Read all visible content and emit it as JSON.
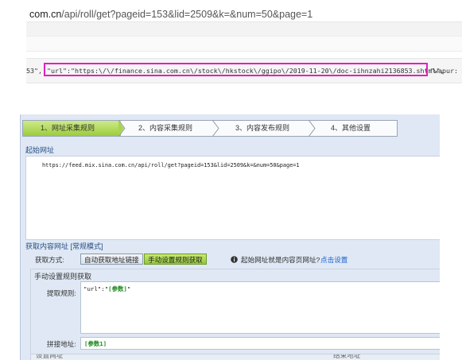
{
  "browser": {
    "url_prefix": "com.cn",
    "url_rest": "/api/roll/get?pageid=153&lid=2509&k=&num=50&page=1"
  },
  "json_view": {
    "before": "53\",",
    "highlight": "\"url\":\"https:\\/\\/finance.sina.com.cn\\/stock\\/hkstock\\/ggipo\\/2019-11-20\\/doc-iihnzahi2136853.shtml\",",
    "after": "\"wapur:"
  },
  "wizard": {
    "steps": [
      "1、网址采集规则",
      "2、内容采集规则",
      "3、内容发布规则",
      "4、其他设置"
    ],
    "active_color": "#a8d44e"
  },
  "start_url_section": {
    "title": "起始网址",
    "url": "https://feed.mix.sina.com.cn/api/roll/get?pageid=153&lid=2509&k=&num=50&page=1"
  },
  "content_url_section": {
    "title": "获取内容网址 [常规模式]",
    "method_label": "获取方式:",
    "auto_btn": "自动获取地址链接",
    "manual_btn": "手动设置规则获取",
    "hint": "起始网址就是内容页网址?",
    "hint_link": "点击设置"
  },
  "manual_section": {
    "title": "手动设置规则获取",
    "rule_label": "提取规则:",
    "rule_value_prefix": "\"url\":\"",
    "rule_value_param": "[参数]",
    "rule_value_suffix": "\"",
    "join_label": "拼接地址:",
    "join_value": "[参数1]"
  },
  "footer_cut": {
    "left": "设置网址",
    "right": "结束地址"
  }
}
